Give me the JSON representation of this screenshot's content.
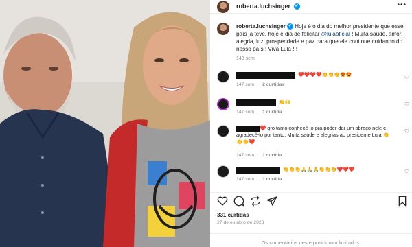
{
  "post": {
    "username": "roberta.luchsinger",
    "verified_badge": "✔",
    "more_icon": "more-horizontal-icon",
    "caption_user": "roberta.luchsinger",
    "caption_part1": " Hoje é o dia do melhor presidente que esse país já teve, hoje é dia de felicitar ",
    "caption_mention": "@lulaoficial",
    "caption_part2": " ! Muita saúde, amor, alegria, luz, prosperidade e paz para que ele continue cuidando do nosso país ! Viva Lula !!!",
    "caption_time": "148 sem",
    "likes": "331 curtidas",
    "date": "27 de outubro de 2023",
    "comments_limited": "Os comentários neste post foram limitados."
  },
  "comments": [
    {
      "emojis": "❤️❤️❤️❤️👏👏👏😍😍",
      "time": "147 sem",
      "likes": "2 curtidas"
    },
    {
      "emojis": "👏🙌",
      "time": "147 sem",
      "likes": "1 curtida"
    },
    {
      "heart": "❤️",
      "text": " qro tanto conhecê-lo pra poder dar um abraço nele e agradecê-lo por tanto. Muita saúde e alegrias ao presidente Lula 👏👏👏❤️",
      "time": "147 sem",
      "likes": "1 curtida"
    },
    {
      "emojis": "👏👏👏🙏🙏🙏👏👏👏❤️❤️❤️",
      "time": "147 sem",
      "likes": "1 curtida"
    }
  ],
  "icons": [
    "heart-icon",
    "comment-icon",
    "share-icon",
    "send-icon",
    "bookmark-icon"
  ],
  "colors": {
    "accent": "#0095f6",
    "mention": "#00376b",
    "muted": "#8e8e8e"
  }
}
